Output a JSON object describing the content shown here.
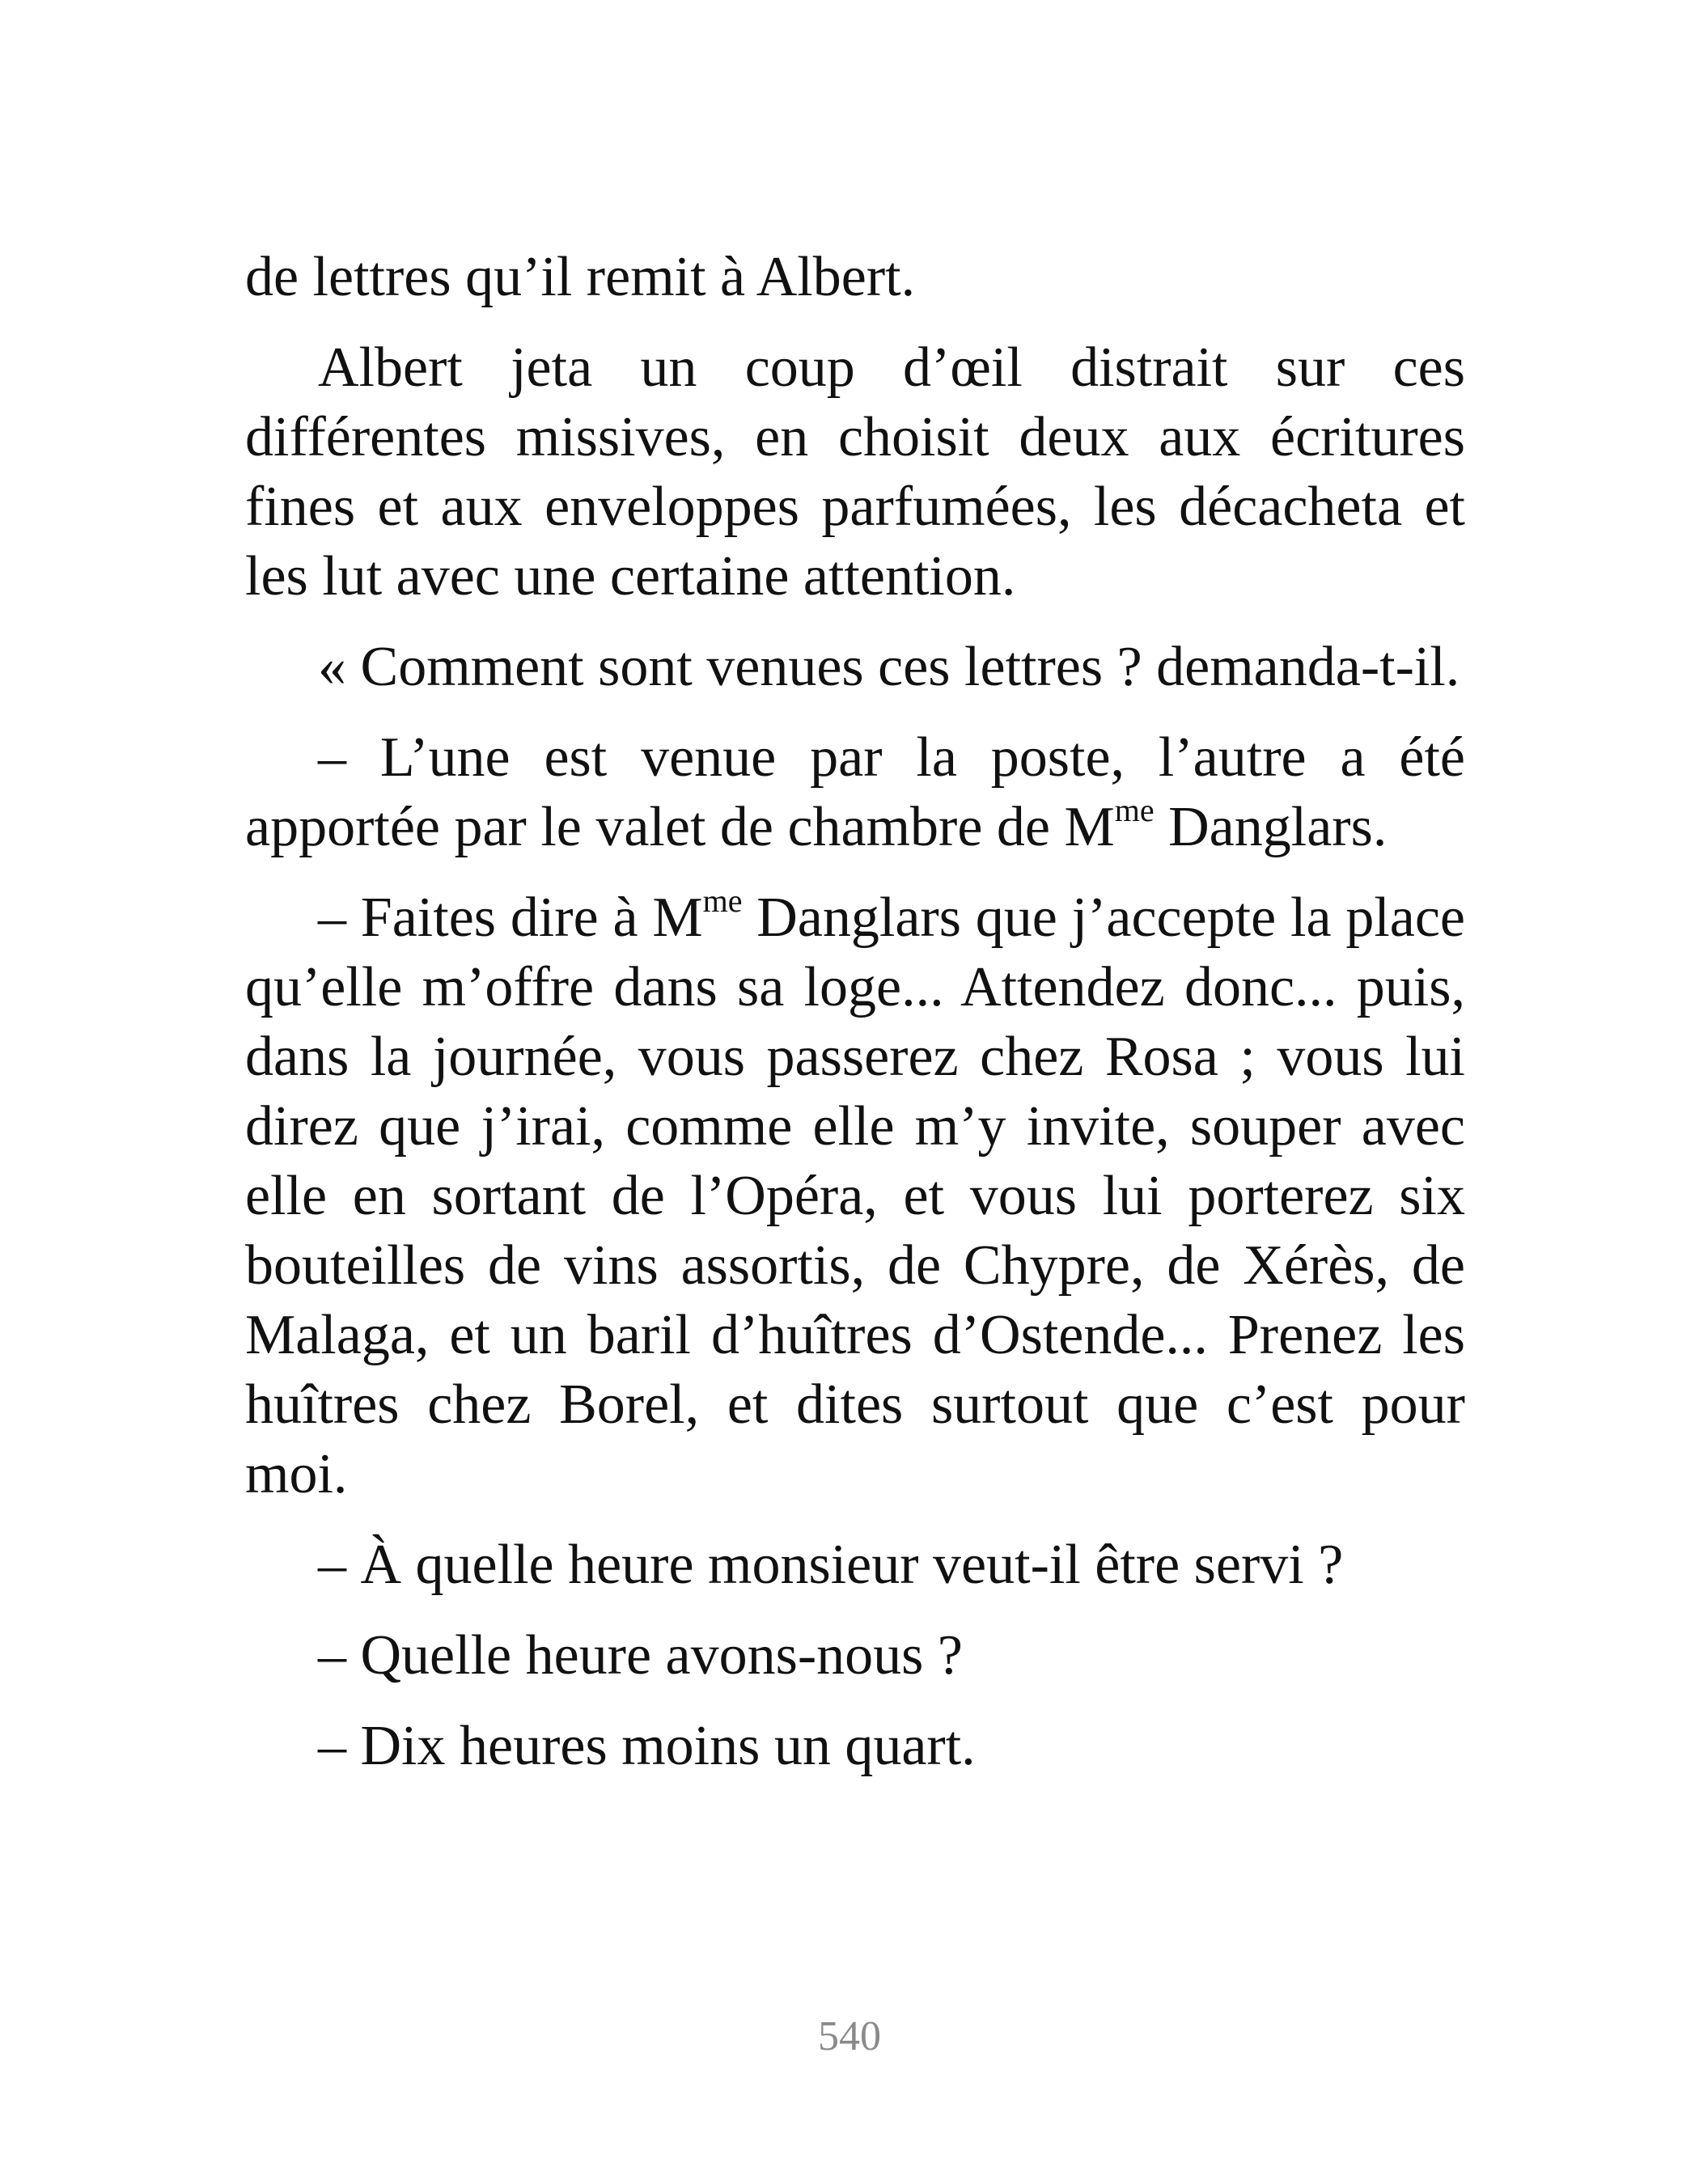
{
  "page": {
    "number": "540",
    "text_color": "#111111",
    "page_number_color": "#8a8a8a"
  },
  "paragraphs": [
    {
      "text": "de lettres qu’il remit à Albert."
    },
    {
      "text": "Albert jeta un coup d’œil distrait sur ces différentes missives, en choisit deux aux écritures fines et aux enveloppes parfumées, les décacheta et les lut avec une certaine attention."
    },
    {
      "text": "« Comment sont venues ces lettres ? demanda-t-il."
    },
    {
      "before": "– L’une est venue par la poste, l’autre a été apportée par le valet de chambre de M",
      "sup": "me",
      "after": " Danglars."
    },
    {
      "before": "– Faites dire à M",
      "sup": "me",
      "after": " Danglars que j’accepte la place qu’elle m’offre dans sa loge... Attendez donc... puis, dans la journée, vous passerez chez Rosa ; vous lui direz que j’irai, comme elle m’y invite, souper avec elle en sortant de l’Opéra, et vous lui porterez six bouteilles de vins assortis, de Chypre, de Xérès, de Malaga, et un baril d’huîtres d’Ostende... Prenez les huîtres chez Borel, et dites surtout que c’est pour moi."
    },
    {
      "text": "– À quelle heure monsieur veut-il être servi ?"
    },
    {
      "text": "– Quelle heure avons-nous ?"
    },
    {
      "text": "– Dix heures moins un quart."
    }
  ]
}
